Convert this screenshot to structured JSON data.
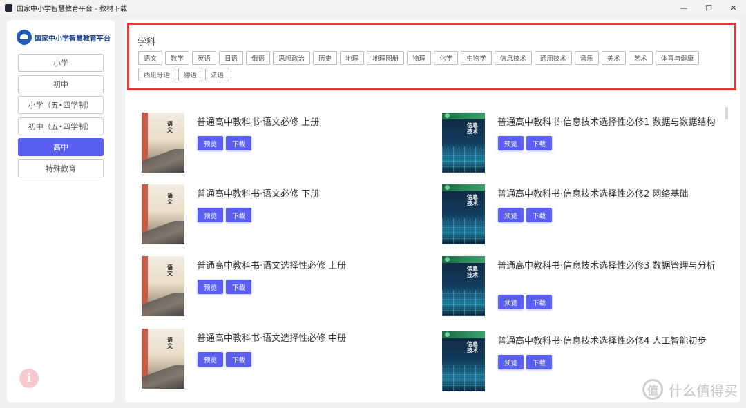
{
  "window": {
    "title": "国家中小学智慧教育平台 - 教材下载",
    "minimize": "—",
    "maximize": "☐",
    "close": "✕"
  },
  "sidebar": {
    "logo_text": "国家中小学智慧教育平台",
    "items": [
      {
        "label": "小学",
        "active": false
      },
      {
        "label": "初中",
        "active": false
      },
      {
        "label": "小学（五•四学制）",
        "active": false
      },
      {
        "label": "初中（五•四学制）",
        "active": false
      },
      {
        "label": "高中",
        "active": true
      },
      {
        "label": "特殊教育",
        "active": false
      }
    ],
    "info_icon": "i"
  },
  "subjects": {
    "title": "学科",
    "tags": [
      "语文",
      "数学",
      "英语",
      "日语",
      "俄语",
      "思想政治",
      "历史",
      "地理",
      "地理图册",
      "物理",
      "化学",
      "生物学",
      "信息技术",
      "通用技术",
      "音乐",
      "美术",
      "艺术",
      "体育与健康",
      "西班牙语",
      "德语",
      "法语"
    ]
  },
  "buttons": {
    "preview": "预览",
    "download": "下载"
  },
  "books": [
    {
      "title": "普通高中教科书·语文必修 上册",
      "cover": "yuwen",
      "cover_text": "语文"
    },
    {
      "title": "普通高中教科书·信息技术选择性必修1 数据与数据结构",
      "cover": "it",
      "cover_text": "信息技术"
    },
    {
      "title": "普通高中教科书·语文必修 下册",
      "cover": "yuwen",
      "cover_text": "语文"
    },
    {
      "title": "普通高中教科书·信息技术选择性必修2 网络基础",
      "cover": "it",
      "cover_text": "信息技术"
    },
    {
      "title": "普通高中教科书·语文选择性必修 上册",
      "cover": "yuwen",
      "cover_text": "语文"
    },
    {
      "title": "普通高中教科书·信息技术选择性必修3 数据管理与分析",
      "cover": "it",
      "cover_text": "信息技术"
    },
    {
      "title": "普通高中教科书·语文选择性必修 中册",
      "cover": "yuwen",
      "cover_text": "语文"
    },
    {
      "title": "普通高中教科书·信息技术选择性必修4 人工智能初步",
      "cover": "it",
      "cover_text": "信息技术"
    }
  ],
  "watermark": {
    "text": "什么值得买",
    "icon": "值"
  },
  "colors": {
    "accent": "#5b5ff0",
    "highlight_border": "#e53935"
  }
}
